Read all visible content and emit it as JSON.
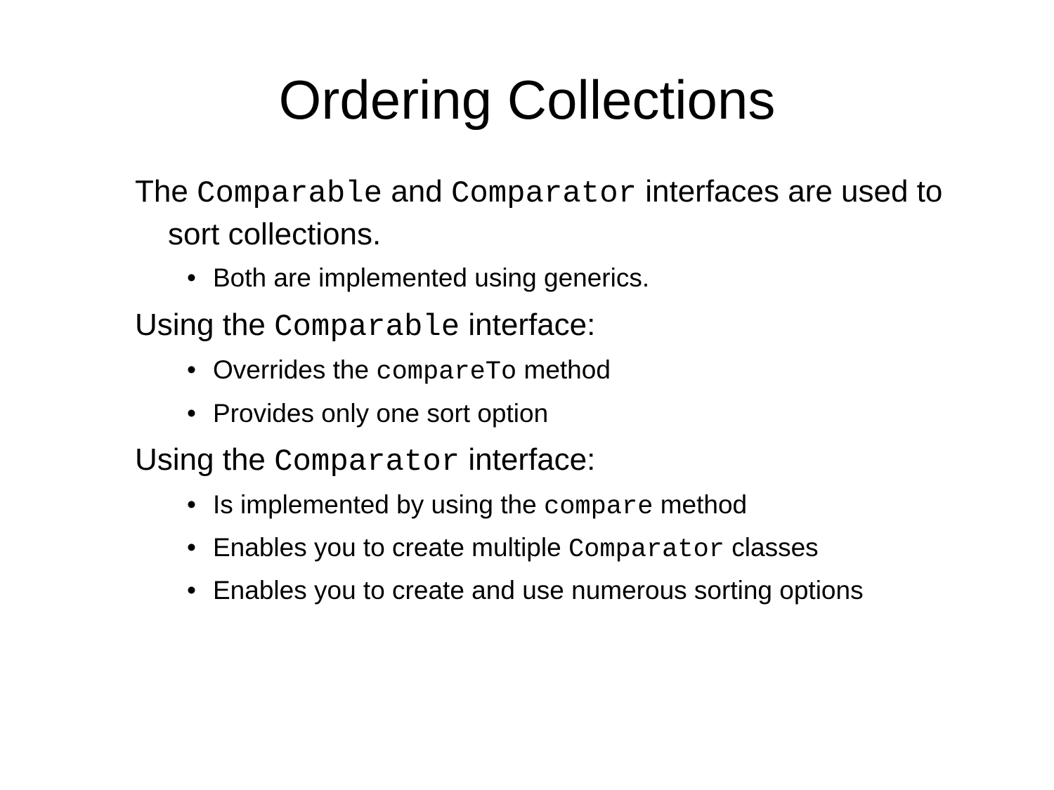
{
  "slide": {
    "title": "Ordering Collections",
    "intro": {
      "t1": "The ",
      "c1": "Comparable",
      "t2": " and ",
      "c2": "Comparator",
      "t3": " interfaces are used to sort collections."
    },
    "intro_bullet": {
      "marker": "•",
      "text": "Both are implemented using generics."
    },
    "comparable_heading": {
      "t1": "Using the ",
      "code": "Comparable",
      "t2": " interface:"
    },
    "comparable_bullets": [
      {
        "marker": "•",
        "t1": "Overrides the ",
        "code": "compareTo",
        "t2": " method"
      },
      {
        "marker": "•",
        "t1": "Provides only one sort option"
      }
    ],
    "comparator_heading": {
      "t1": "Using the ",
      "code": "Comparator",
      "t2": " interface:"
    },
    "comparator_bullets": [
      {
        "marker": "•",
        "t1": "Is implemented by using the ",
        "code": "compare",
        "t2": " method"
      },
      {
        "marker": "•",
        "t1": "Enables you to create multiple ",
        "code": "Comparator",
        "t2": " classes"
      },
      {
        "marker": "•",
        "t1": "Enables you to create and use numerous sorting options"
      }
    ]
  }
}
